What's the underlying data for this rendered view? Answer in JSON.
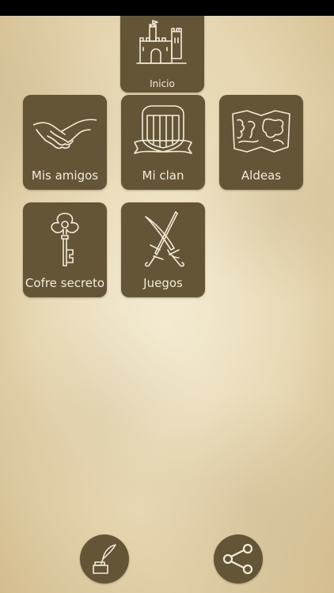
{
  "menu": {
    "home": {
      "label": "Inicio",
      "icon": "castle-icon"
    },
    "tiles": [
      {
        "label": "Mis amigos",
        "icon": "handshake-icon"
      },
      {
        "label": "Mi clan",
        "icon": "clan-shield-icon"
      },
      {
        "label": "Aldeas",
        "icon": "map-icon"
      },
      {
        "label": "Cofre secreto",
        "icon": "key-icon"
      },
      {
        "label": "Juegos",
        "icon": "crossed-swords-icon"
      }
    ]
  },
  "bottom_bar": {
    "left_button": {
      "icon": "quill-inkwell-icon"
    },
    "right_button": {
      "icon": "share-icon"
    }
  },
  "colors": {
    "tile_background": "#645537",
    "tile_text": "#f4ecd8",
    "parchment": "#e6d6b1",
    "status_bar": "#000000"
  }
}
